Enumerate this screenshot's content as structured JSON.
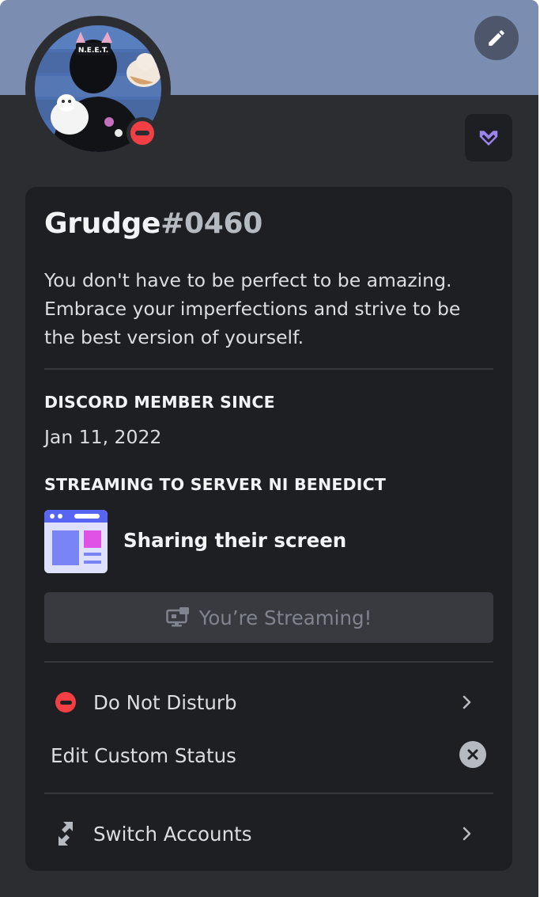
{
  "profile": {
    "username": "Grudge",
    "discriminator": "#0460",
    "bio": "You don't have to be perfect to be amazing. Embrace your imperfections and strive to be the best version of yourself.",
    "banner_color": "#7b8db1",
    "status": "dnd"
  },
  "member_since": {
    "title": "DISCORD MEMBER SINCE",
    "date": "Jan 11, 2022"
  },
  "streaming": {
    "title": "STREAMING TO SERVER NI BENEDICT",
    "activity": "Sharing their screen",
    "button_label": "You’re Streaming!"
  },
  "status_menu": {
    "status_label": "Do Not Disturb",
    "custom_status_label": "Edit Custom Status"
  },
  "account_menu": {
    "switch_label": "Switch Accounts"
  },
  "icons": {
    "edit": "pencil-icon",
    "badge": "hypesquad-icon",
    "status": "dnd-icon",
    "clear": "close-icon",
    "stream": "screen-share-icon",
    "switch": "switch-accounts-icon",
    "chevron": "chevron-right-icon"
  },
  "colors": {
    "dnd": "#f23f43",
    "card": "#1e1f22",
    "popout": "#2b2d31"
  }
}
